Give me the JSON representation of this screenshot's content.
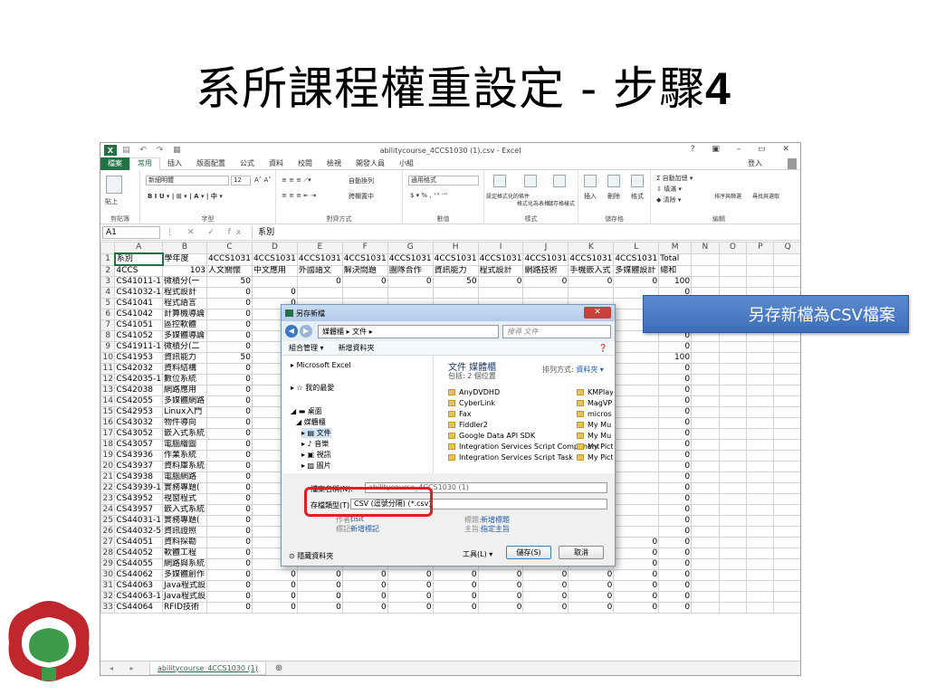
{
  "slide": {
    "title_main": "系所課程權重設定 - 步驟",
    "title_num": "4",
    "callout": "另存新檔為CSV檔案"
  },
  "excel": {
    "title": "abilitycourse_4CCS1030 (1).csv - Excel",
    "help": "?",
    "menu": [
      "檔案",
      "常用",
      "插入",
      "版面配置",
      "公式",
      "資料",
      "校閱",
      "檢視",
      "開發人員",
      "小組"
    ],
    "signin": "登入",
    "ribbon": {
      "font_name": "新細明體",
      "font_size": "12",
      "number_format": "通用格式",
      "paste": "貼上",
      "clipboard": "剪貼簿",
      "font": "字型",
      "alignment": "對齊方式",
      "number": "數值",
      "styles": "樣式",
      "cells": "儲存格",
      "editing": "編輯",
      "wrap": "自動換列",
      "merge": "跨欄置中",
      "autosum": "自動加總",
      "fill": "填滿",
      "clear": "清除",
      "sort": "排序與篩選",
      "find": "尋找與選取",
      "cond": "設定格式化的條件",
      "table": "格式化為表格",
      "cellstyle": "儲存格樣式",
      "insert": "插入",
      "delete": "刪除",
      "format": "格式"
    },
    "namebox": "A1",
    "formula": "系別",
    "cols": [
      "A",
      "B",
      "C",
      "D",
      "E",
      "F",
      "G",
      "H",
      "I",
      "J",
      "K",
      "L",
      "M",
      "N",
      "O",
      "P",
      "Q"
    ],
    "rows": [
      [
        "1",
        "系別",
        "學年度",
        "4CCS1031",
        "4CCS1031",
        "4CCS1031",
        "4CCS1031",
        "4CCS1031",
        "4CCS1031",
        "4CCS1031",
        "4CCS1031",
        "4CCS1031",
        "4CCS1031",
        "Total"
      ],
      [
        "2",
        "4CCS",
        "103",
        "人文關懷",
        "中文應用",
        "外國語文",
        "解決問題",
        "團隊合作",
        "資訊能力",
        "程式設計",
        "網路技術",
        "手機嵌入式",
        "多媒體設計",
        "總和"
      ],
      [
        "3",
        "CS41011-1",
        "微積分(一",
        "50",
        "",
        "0",
        "0",
        "0",
        "50",
        "0",
        "0",
        "0",
        "0",
        "100"
      ],
      [
        "4",
        "CS41032-1",
        "程式設計",
        "0",
        "0",
        "",
        "",
        "",
        "",
        "",
        "",
        "",
        "",
        "0"
      ],
      [
        "5",
        "CS41041",
        "程式語言",
        "0",
        "0",
        "",
        "",
        "",
        "",
        "",
        "",
        "",
        "",
        "0"
      ],
      [
        "6",
        "CS41042",
        "計算機導論",
        "0",
        "0",
        "",
        "",
        "",
        "",
        "",
        "",
        "",
        "",
        "0"
      ],
      [
        "7",
        "CS41051",
        "區控軟體",
        "0",
        "0",
        "",
        "",
        "",
        "",
        "",
        "",
        "",
        "",
        "0"
      ],
      [
        "8",
        "CS41052",
        "多媒體導論",
        "0",
        "0",
        "",
        "",
        "",
        "",
        "",
        "",
        "",
        "",
        "0"
      ],
      [
        "9",
        "CS41911-1",
        "微積分(二",
        "0",
        "0",
        "",
        "",
        "",
        "",
        "",
        "",
        "",
        "",
        "0"
      ],
      [
        "10",
        "CS41953",
        "資訊能力",
        "50",
        "0",
        "",
        "",
        "",
        "",
        "",
        "",
        "",
        "",
        "100"
      ],
      [
        "11",
        "CS42032",
        "資料結構",
        "0",
        "0",
        "",
        "",
        "",
        "",
        "",
        "",
        "",
        "",
        "0"
      ],
      [
        "12",
        "CS42035-1",
        "數位系統",
        "0",
        "0",
        "",
        "",
        "",
        "",
        "",
        "",
        "",
        "",
        "0"
      ],
      [
        "13",
        "CS42038",
        "網路應用",
        "0",
        "0",
        "",
        "",
        "",
        "",
        "",
        "",
        "",
        "",
        "0"
      ],
      [
        "14",
        "CS42055",
        "多媒體網路",
        "0",
        "0",
        "",
        "",
        "",
        "",
        "",
        "",
        "",
        "",
        "0"
      ],
      [
        "15",
        "CS42953",
        "Linux入門",
        "0",
        "0",
        "",
        "",
        "",
        "",
        "",
        "",
        "",
        "",
        "0"
      ],
      [
        "16",
        "CS43032",
        "物件導向",
        "0",
        "0",
        "",
        "",
        "",
        "",
        "",
        "",
        "",
        "",
        "0"
      ],
      [
        "17",
        "CS43052",
        "嵌入式系統",
        "0",
        "0",
        "",
        "",
        "",
        "",
        "",
        "",
        "",
        "",
        "0"
      ],
      [
        "18",
        "CS43057",
        "電腦繪圖",
        "0",
        "0",
        "",
        "",
        "",
        "",
        "",
        "",
        "",
        "",
        "0"
      ],
      [
        "19",
        "CS43936",
        "作業系統",
        "0",
        "0",
        "",
        "",
        "",
        "",
        "",
        "",
        "",
        "",
        "0"
      ],
      [
        "20",
        "CS43937",
        "資料庫系統",
        "0",
        "0",
        "",
        "",
        "",
        "",
        "",
        "",
        "",
        "",
        "0"
      ],
      [
        "21",
        "CS43938",
        "電腦網路",
        "0",
        "0",
        "",
        "",
        "",
        "",
        "",
        "",
        "",
        "",
        "0"
      ],
      [
        "22",
        "CS43939-1",
        "實務專題(",
        "0",
        "0",
        "",
        "",
        "",
        "",
        "",
        "",
        "",
        "",
        "0"
      ],
      [
        "23",
        "CS43952",
        "視窗程式",
        "0",
        "0",
        "",
        "",
        "",
        "",
        "",
        "",
        "",
        "",
        "0"
      ],
      [
        "24",
        "CS43957",
        "嵌入式系統",
        "0",
        "0",
        "",
        "",
        "",
        "",
        "",
        "",
        "",
        "",
        "0"
      ],
      [
        "25",
        "CS44031-1",
        "實務專題(",
        "0",
        "0",
        "",
        "",
        "",
        "",
        "",
        "",
        "",
        "",
        "0"
      ],
      [
        "26",
        "CS44032-5",
        "資訊證照",
        "0",
        "0",
        "",
        "",
        "",
        "",
        "",
        "",
        "",
        "",
        "0"
      ],
      [
        "27",
        "CS44051",
        "資料探勘",
        "0",
        "0",
        "0",
        "0",
        "0",
        "0",
        "0",
        "0",
        "0",
        "0",
        "0"
      ],
      [
        "28",
        "CS44052",
        "軟體工程",
        "0",
        "0",
        "0",
        "0",
        "0",
        "0",
        "0",
        "0",
        "0",
        "0",
        "0"
      ],
      [
        "29",
        "CS44055",
        "網路與系統",
        "0",
        "0",
        "0",
        "0",
        "0",
        "0",
        "0",
        "0",
        "0",
        "0",
        "0"
      ],
      [
        "30",
        "CS44062",
        "多媒體創作",
        "0",
        "0",
        "0",
        "0",
        "0",
        "0",
        "0",
        "0",
        "0",
        "0",
        "0"
      ],
      [
        "31",
        "CS44063",
        "Java程式設",
        "0",
        "0",
        "0",
        "0",
        "0",
        "0",
        "0",
        "0",
        "0",
        "0",
        "0"
      ],
      [
        "32",
        "CS44063-1",
        "Java程式設",
        "0",
        "0",
        "0",
        "0",
        "0",
        "0",
        "0",
        "0",
        "0",
        "0",
        "0"
      ],
      [
        "33",
        "CS44064",
        "RFID技術",
        "0",
        "0",
        "0",
        "0",
        "0",
        "0",
        "0",
        "0",
        "0",
        "0",
        "0"
      ]
    ],
    "sheet_tab": "abilitycourse_4CCS1030 (1)"
  },
  "dialog": {
    "title": "另存新檔",
    "path": "媒體櫃 ▸ 文件 ▸",
    "search": "搜尋 文件",
    "organize": "組合管理 ▾",
    "newfolder": "新增資料夾",
    "tree": [
      "Microsoft Excel",
      "我的最愛",
      "桌面",
      "媒體櫃",
      "文件",
      "音樂",
      "視訊",
      "圖片"
    ],
    "lib_title": "文件 媒體櫃",
    "lib_sub": "包括: 2 個位置",
    "sort_label": "排列方式:",
    "sort_value": "資料夾 ▾",
    "files": [
      "AnyDVDHD",
      "CyberLink",
      "Fax",
      "Fiddler2",
      "Google Data API SDK",
      "Integration Services Script Component",
      "Integration Services Script Task"
    ],
    "files2": [
      "KMPlay",
      "MagVP",
      "micros",
      "My Mu",
      "My Mu",
      "My Pict",
      "My Pict"
    ],
    "filename_label": "檔案名稱(N):",
    "filename": "abilitycourse_4CCS1030 (1)",
    "type_label": "存檔類型(T):",
    "type": "CSV (逗號分隔) (*.csv)",
    "author_label": "作者:",
    "author": "tisit",
    "tags_label": "標記:",
    "tags": "新增標記",
    "title_label": "標題:",
    "title_val": "新增標題",
    "subject_label": "主旨:",
    "subject": "指定主旨",
    "hide": "隱藏資料夾",
    "tools": "工具(L)",
    "save": "儲存(S)",
    "cancel": "取消"
  }
}
